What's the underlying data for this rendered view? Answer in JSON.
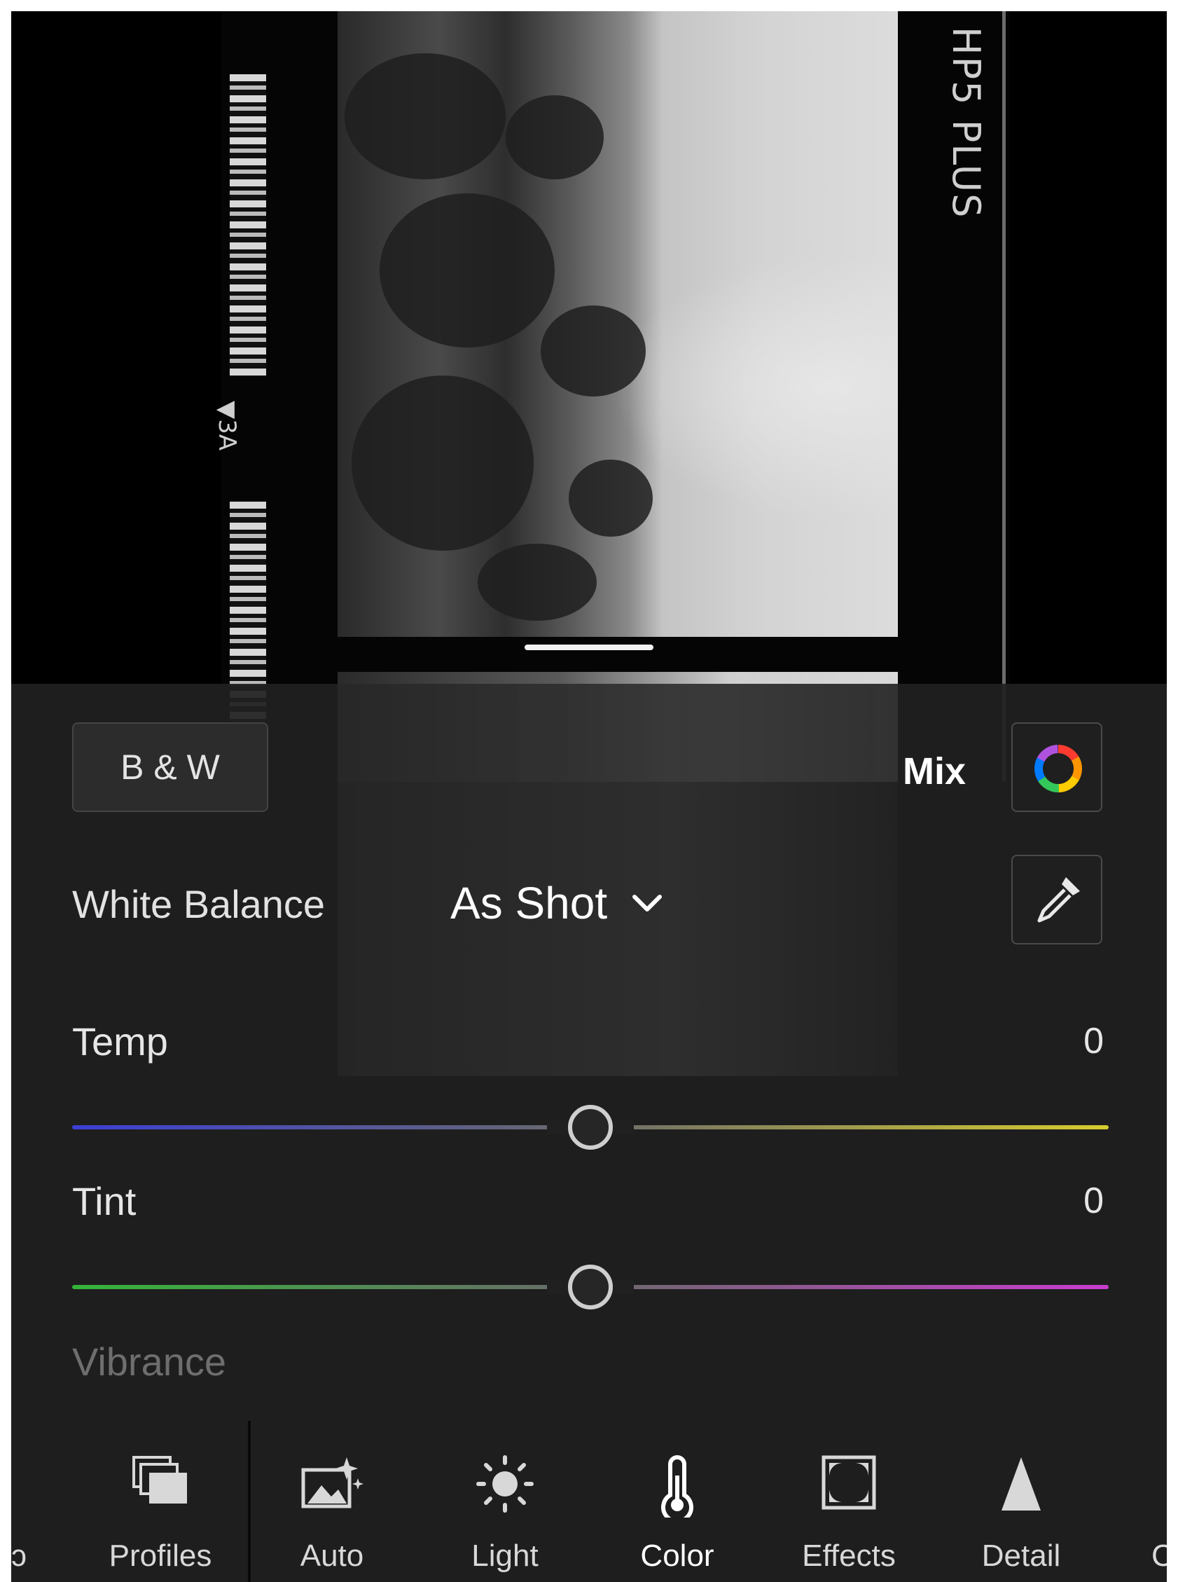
{
  "film": {
    "frame_label": "▼3A",
    "brand": "HP5 PLUS"
  },
  "panel": {
    "bw_label": "B & W",
    "mix_label": "Mix",
    "white_balance": {
      "label": "White Balance",
      "value": "As Shot"
    },
    "sliders": [
      {
        "label": "Temp",
        "value": "0",
        "level": 0.5,
        "colors": [
          "#3c3fd6",
          "#d6cc2e"
        ]
      },
      {
        "label": "Tint",
        "value": "0",
        "level": 0.5,
        "colors": [
          "#34b53a",
          "#c93ccf"
        ]
      }
    ],
    "next_section_label": "Vibrance"
  },
  "toolbar": {
    "left_edge": "ɔ",
    "right_edge": "C",
    "tools": [
      {
        "label": "Profiles",
        "icon": "profiles-icon"
      },
      {
        "label": "Auto",
        "icon": "auto-icon"
      },
      {
        "label": "Light",
        "icon": "light-icon"
      },
      {
        "label": "Color",
        "icon": "color-thermometer-icon"
      },
      {
        "label": "Effects",
        "icon": "effects-icon"
      },
      {
        "label": "Detail",
        "icon": "detail-icon"
      }
    ]
  }
}
